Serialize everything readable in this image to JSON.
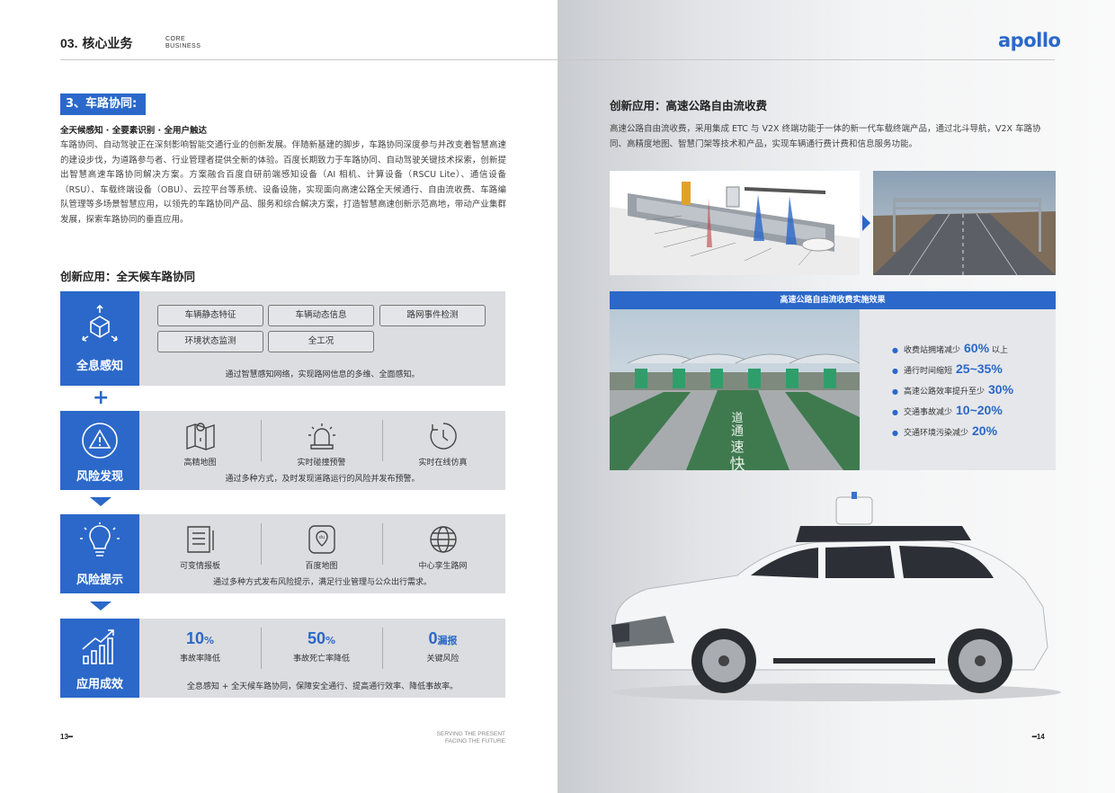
{
  "header": {
    "title_num": "03.",
    "title_text": "核心业务",
    "en_line1": "CORE",
    "en_line2": "BUSINESS",
    "logo": "apollo"
  },
  "section": {
    "badge": "3、车路协同:",
    "subtitle": "全天候感知 · 全要素识别 · 全用户触达",
    "body": "车路协同、自动驾驶正在深刻影响智能交通行业的创新发展。伴随新基建的脚步，车路协同深度参与并改变着智慧高速的建设步伐，为道路参与者、行业管理者提供全新的体验。百度长期致力于车路协同、自动驾驶关键技术探索，创新提出智慧高速车路协同解决方案。方案融合百度自研前端感知设备（AI 相机、计算设备（RSCU Lite）、通信设备（RSU）、车载终端设备（OBU）、云控平台等系统、设备设施，实现面向高速公路全天候通行、自由流收费、车路编队管理等多场景智慧应用，以领先的车路协同产品、服务和综合解决方案，打造智慧高速创新示范高地，带动产业集群发展，探索车路协同的垂直应用。"
  },
  "left_heading": "创新应用：全天候车路协同",
  "blocks": {
    "perception": {
      "label": "全息感知",
      "tags": [
        "车辆静态特征",
        "车辆动态信息",
        "路网事件检测",
        "环境状态监测",
        "全工况"
      ],
      "caption": "通过智慧感知网络，实现路网信息的多维、全面感知。"
    },
    "risk_detect": {
      "label": "风险发现",
      "items": [
        "高精地图",
        "实时碰撞预警",
        "实时在线仿真"
      ],
      "caption": "通过多种方式，及时发现道路运行的风险并发布预警。"
    },
    "risk_alert": {
      "label": "风险提示",
      "items": [
        "可变情报板",
        "百度地图",
        "中心孪生路网"
      ],
      "caption": "通过多种方式发布风险提示，满足行业管理与公众出行需求。"
    },
    "effect": {
      "label": "应用成效",
      "stats": [
        {
          "value": "10",
          "unit": "%",
          "label": "事故率降低"
        },
        {
          "value": "50",
          "unit": "%",
          "label": "事故死亡率降低"
        },
        {
          "value": "0",
          "unit": "漏报",
          "label": "关键风险"
        }
      ],
      "caption": "全息感知 + 全天候车路协同，保障安全通行、提高通行效率、降低事故率。"
    }
  },
  "plus_sign": "+",
  "footer": {
    "left": "13",
    "center_line1": "SERVING THE PRESENT",
    "center_line2": "FACING THE FUTURE",
    "right": "14"
  },
  "right": {
    "heading": "创新应用：高速公路自由流收费",
    "body": "高速公路自由流收费，采用集成 ETC 与 V2X 终端功能于一体的新一代车载终端产品，通过北斗导航，V2X 车路协同、高精度地图、智慧门架等技术和产品，实现车辆通行费计费和信息服务功能。",
    "effect_title": "高速公路自由流收费实施效果",
    "effects": [
      {
        "text": "收费站拥堵减少",
        "value": "60%",
        "suffix": "以上"
      },
      {
        "text": "通行时间缩短",
        "value": "25~35%",
        "suffix": ""
      },
      {
        "text": "高速公路效率提升至少",
        "value": "30%",
        "suffix": ""
      },
      {
        "text": "交通事故减少",
        "value": "10~20%",
        "suffix": ""
      },
      {
        "text": "交通环境污染减少",
        "value": "20%",
        "suffix": ""
      }
    ],
    "road_text": [
      "道",
      "通",
      "速",
      "快"
    ]
  },
  "colors": {
    "accent": "#2b68c9",
    "block_bg": "#dcdde0"
  }
}
